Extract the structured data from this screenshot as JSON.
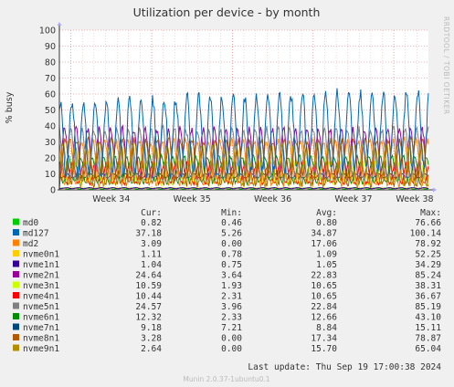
{
  "chart_data": {
    "type": "line",
    "title": "Utilization per device - by month",
    "ylabel": "% busy",
    "ylim": [
      0,
      100
    ],
    "yticks": [
      0,
      10,
      20,
      30,
      40,
      50,
      60,
      70,
      80,
      90,
      100
    ],
    "xlim": [
      "2024-08-18",
      "2024-09-19"
    ],
    "x_ticks": [
      {
        "label": "Week 34",
        "date": "2024-08-19"
      },
      {
        "label": "Week 35",
        "date": "2024-08-26"
      },
      {
        "label": "Week 36",
        "date": "2024-09-02"
      },
      {
        "label": "Week 37",
        "date": "2024-09-09"
      },
      {
        "label": "Week 38",
        "date": "2024-09-16"
      }
    ],
    "grid": true,
    "legend_headers": {
      "cur": "Cur:",
      "min": "Min:",
      "avg": "Avg:",
      "max": "Max:"
    },
    "series": [
      {
        "name": "md0",
        "color": "#00cc00",
        "cur": "0.82",
        "min": "0.46",
        "avg": "0.80",
        "max": "76.66"
      },
      {
        "name": "md127",
        "color": "#0066b3",
        "cur": "37.18",
        "min": "5.26",
        "avg": "34.87",
        "max": "100.14"
      },
      {
        "name": "md2",
        "color": "#ff8000",
        "cur": "3.09",
        "min": "0.00",
        "avg": "17.06",
        "max": "78.92"
      },
      {
        "name": "nvme0n1",
        "color": "#ffcc00",
        "cur": "1.11",
        "min": "0.78",
        "avg": "1.09",
        "max": "52.25"
      },
      {
        "name": "nvme1n1",
        "color": "#330099",
        "cur": "1.04",
        "min": "0.75",
        "avg": "1.05",
        "max": "34.29"
      },
      {
        "name": "nvme2n1",
        "color": "#990099",
        "cur": "24.64",
        "min": "3.64",
        "avg": "22.83",
        "max": "85.24"
      },
      {
        "name": "nvme3n1",
        "color": "#ccff00",
        "cur": "10.59",
        "min": "1.93",
        "avg": "10.65",
        "max": "38.31"
      },
      {
        "name": "nvme4n1",
        "color": "#ff0000",
        "cur": "10.44",
        "min": "2.31",
        "avg": "10.65",
        "max": "36.67"
      },
      {
        "name": "nvme5n1",
        "color": "#808080",
        "cur": "24.57",
        "min": "3.96",
        "avg": "22.84",
        "max": "85.19"
      },
      {
        "name": "nvme6n1",
        "color": "#008f00",
        "cur": "12.32",
        "min": "2.33",
        "avg": "12.66",
        "max": "43.10"
      },
      {
        "name": "nvme7n1",
        "color": "#00487d",
        "cur": "9.18",
        "min": "7.21",
        "avg": "8.84",
        "max": "15.11"
      },
      {
        "name": "nvme8n1",
        "color": "#b35a00",
        "cur": "3.28",
        "min": "0.00",
        "avg": "17.34",
        "max": "78.87"
      },
      {
        "name": "nvme9n1",
        "color": "#b38f00",
        "cur": "2.64",
        "min": "0.00",
        "avg": "15.70",
        "max": "65.04"
      }
    ]
  },
  "side_label": "RRDTOOL / TOBI OETIKER",
  "last_update": "Last update: Thu Sep 19 17:00:38 2024",
  "footer": "Munin 2.0.37-1ubuntu0.1"
}
